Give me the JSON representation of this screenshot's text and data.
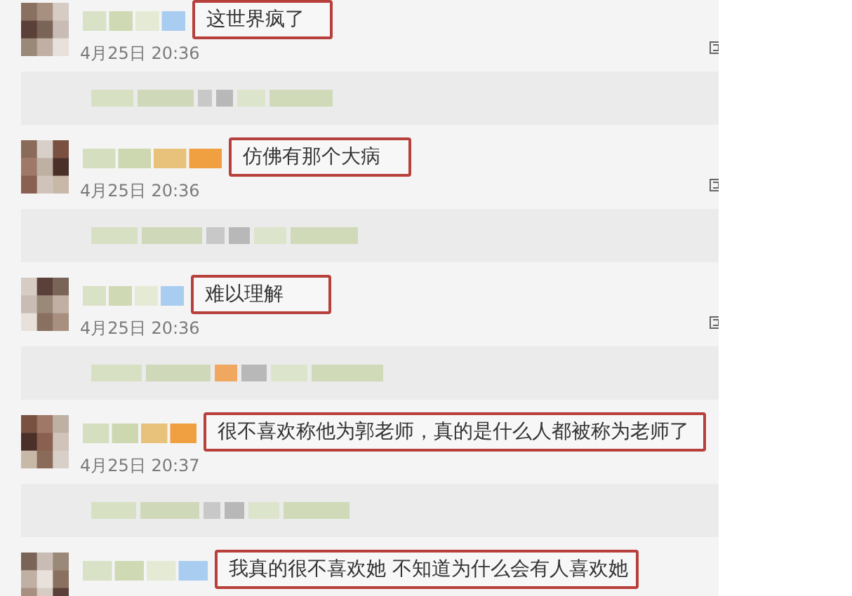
{
  "comments": [
    {
      "text": "这世界疯了",
      "time": "4月25日 20:36",
      "action_icon": true
    },
    {
      "text": "仿佛有那个大病",
      "time": "4月25日 20:36",
      "action_icon": true
    },
    {
      "text": "难以理解",
      "time": "4月25日 20:36",
      "action_icon": true
    },
    {
      "text": "很不喜欢称他为郭老师，真的是什么人都被称为老师了",
      "time": "4月25日 20:37",
      "action_icon": false
    },
    {
      "text": "我真的很不喜欢她 不知道为什么会有人喜欢她",
      "action_icon": false
    }
  ]
}
